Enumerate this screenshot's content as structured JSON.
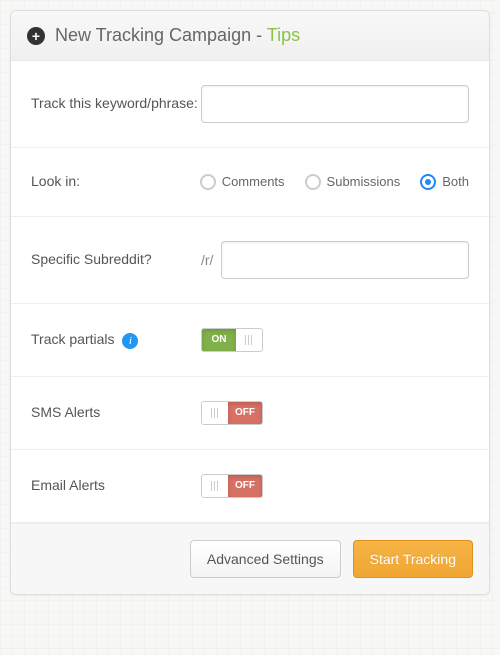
{
  "header": {
    "title_main": "New Tracking Campaign - ",
    "title_tips": "Tips"
  },
  "fields": {
    "keyword": {
      "label": "Track this keyword/phrase:",
      "value": ""
    },
    "lookin": {
      "label": "Look in:",
      "options": {
        "comments": "Comments",
        "submissions": "Submissions",
        "both": "Both"
      },
      "selected": "both"
    },
    "subreddit": {
      "label": "Specific Subreddit?",
      "prefix": "/r/",
      "value": ""
    },
    "partials": {
      "label": "Track partials",
      "state": "on",
      "on_label": "ON"
    },
    "sms": {
      "label": "SMS Alerts",
      "state": "off",
      "off_label": "OFF"
    },
    "email": {
      "label": "Email Alerts",
      "state": "off",
      "off_label": "OFF"
    }
  },
  "footer": {
    "advanced": "Advanced Settings",
    "start": "Start Tracking"
  }
}
